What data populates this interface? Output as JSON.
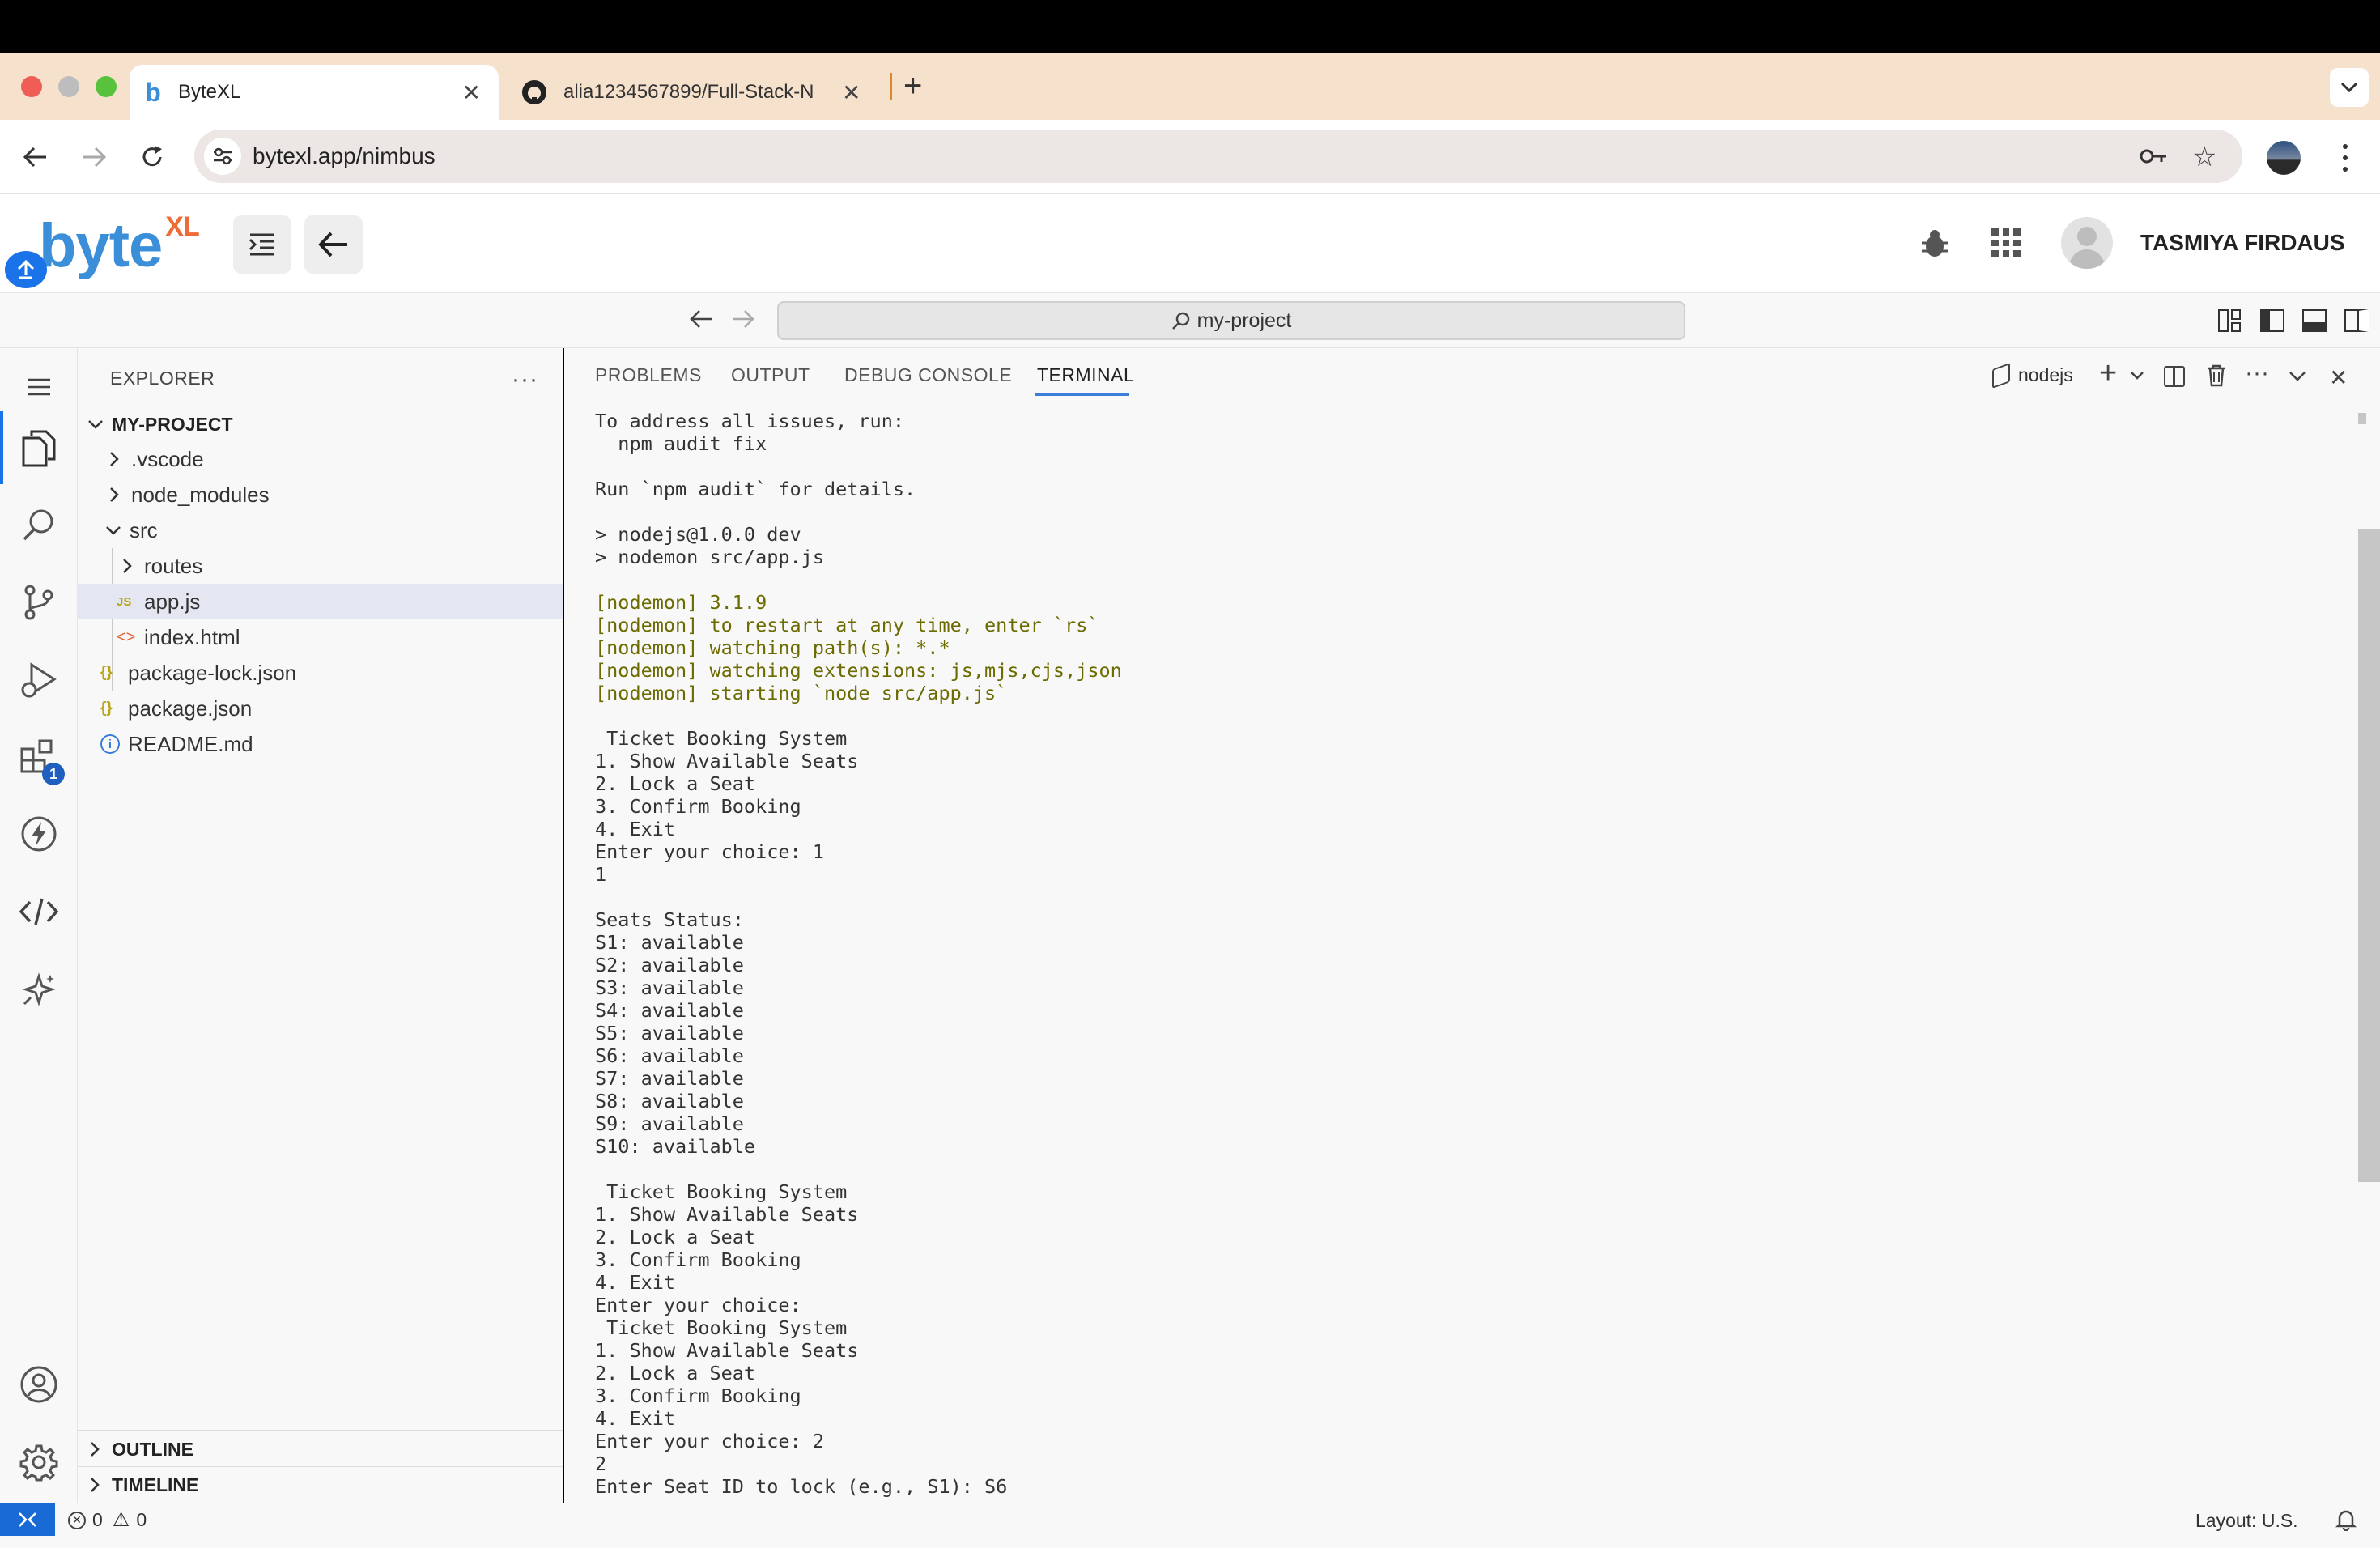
{
  "browser": {
    "tabs": [
      {
        "title": "ByteXL",
        "active": true
      },
      {
        "title": "alia1234567899/Full-Stack-N",
        "active": false
      }
    ],
    "url": "bytexl.app/nimbus"
  },
  "app": {
    "logo_text": "byte",
    "logo_sup": "XL",
    "user_name": "TASMIYA FIRDAUS"
  },
  "command_center": {
    "text": "my-project"
  },
  "explorer": {
    "title": "EXPLORER",
    "root": "MY-PROJECT",
    "items": [
      {
        "label": ".vscode",
        "kind": "folder",
        "expanded": false
      },
      {
        "label": "node_modules",
        "kind": "folder",
        "expanded": false
      },
      {
        "label": "src",
        "kind": "folder",
        "expanded": true
      },
      {
        "label": "routes",
        "kind": "folder",
        "expanded": false
      },
      {
        "label": "app.js",
        "kind": "js",
        "selected": true
      },
      {
        "label": "index.html",
        "kind": "html"
      },
      {
        "label": "package-lock.json",
        "kind": "json"
      },
      {
        "label": "package.json",
        "kind": "json"
      },
      {
        "label": "README.md",
        "kind": "info"
      }
    ],
    "outline": "OUTLINE",
    "timeline": "TIMELINE"
  },
  "activity_badge": "1",
  "panel": {
    "tabs": [
      "PROBLEMS",
      "OUTPUT",
      "DEBUG CONSOLE",
      "TERMINAL"
    ],
    "active_tab": "TERMINAL",
    "terminal_name": "nodejs"
  },
  "terminal": {
    "lines": [
      "To address all issues, run:",
      "  npm audit fix",
      "",
      "Run `npm audit` for details.",
      "",
      "> nodejs@1.0.0 dev",
      "> nodemon src/app.js",
      "",
      "[nodemon] 3.1.9",
      "[nodemon] to restart at any time, enter `rs`",
      "[nodemon] watching path(s): *.*",
      "[nodemon] watching extensions: js,mjs,cjs,json",
      "[nodemon] starting `node src/app.js`",
      "",
      " Ticket Booking System",
      "1. Show Available Seats",
      "2. Lock a Seat",
      "3. Confirm Booking",
      "4. Exit",
      "Enter your choice: 1",
      "1",
      "",
      "Seats Status:",
      "S1: available",
      "S2: available",
      "S3: available",
      "S4: available",
      "S5: available",
      "S6: available",
      "S7: available",
      "S8: available",
      "S9: available",
      "S10: available",
      "",
      " Ticket Booking System",
      "1. Show Available Seats",
      "2. Lock a Seat",
      "3. Confirm Booking",
      "4. Exit",
      "Enter your choice:",
      " Ticket Booking System",
      "1. Show Available Seats",
      "2. Lock a Seat",
      "3. Confirm Booking",
      "4. Exit",
      "Enter your choice: 2",
      "2",
      "Enter Seat ID to lock (e.g., S1): S6"
    ]
  },
  "statusbar": {
    "errors": "0",
    "warnings": "0",
    "layout": "Layout: U.S."
  },
  "colors": {
    "tabbar_bg": "#f6e2cc",
    "accent_blue": "#3b8fd8",
    "logo_orange": "#ef6b35",
    "nodemon_text": "#6b6b00"
  }
}
